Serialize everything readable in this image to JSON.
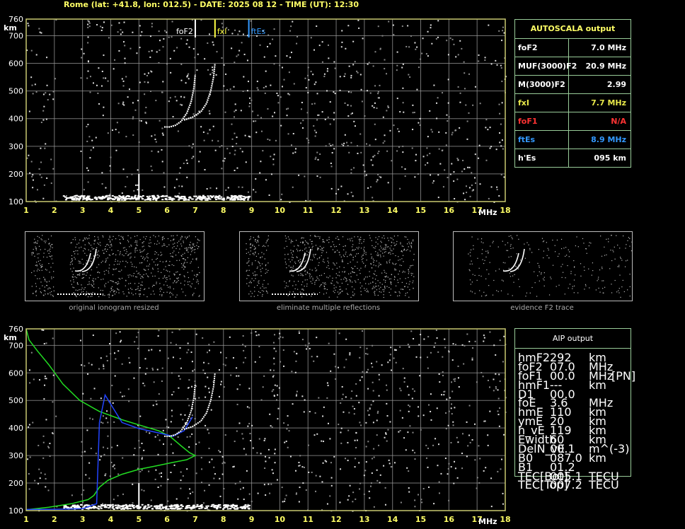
{
  "header": "Rome (lat: +41.8, lon: 012.5) - DATE: 2025 08 12 - TIME (UT): 12:30",
  "colors": {
    "accent": "#ffff66",
    "frame": "#c8c870",
    "grid": "#9a9a9a",
    "fxI": "#ffff44",
    "ftEs": "#3399ff",
    "foF1": "#ff3333",
    "profile": "#22dd22",
    "blue": "#2244ff"
  },
  "axes": {
    "x_unit": "MHz",
    "y_unit": "km",
    "x_ticks": [
      "1",
      "2",
      "3",
      "4",
      "5",
      "6",
      "7",
      "8",
      "9",
      "10",
      "11",
      "12",
      "13",
      "14",
      "15",
      "16",
      "17",
      "18"
    ],
    "y_ticks": [
      "100",
      "200",
      "300",
      "400",
      "500",
      "600",
      "700",
      "760"
    ]
  },
  "top_plot_labels": {
    "foF2": "foF2",
    "fxI": "fxI",
    "ftEs": "ftEs"
  },
  "autoscala": {
    "title": "AUTOSCALA output",
    "rows": [
      {
        "label": "foF2",
        "value": "7.0 MHz",
        "color": "#ffffff"
      },
      {
        "label": "MUF(3000)F2",
        "value": "20.9 MHz",
        "color": "#ffffff"
      },
      {
        "label": "M(3000)F2",
        "value": "2.99",
        "color": "#ffffff"
      },
      {
        "label": "fxI",
        "value": "7.7 MHz",
        "color": "#e8e84a"
      },
      {
        "label": "foF1",
        "value": "N/A",
        "color": "#ff3333"
      },
      {
        "label": "ftEs",
        "value": "8.9 MHz",
        "color": "#3399ff"
      },
      {
        "label": "h'Es",
        "value": "095     km",
        "color": "#ffffff"
      }
    ]
  },
  "thumbnails": [
    {
      "caption": "original ionogram resized"
    },
    {
      "caption": "eliminate multiple reflections"
    },
    {
      "caption": "evidence F2 trace"
    }
  ],
  "aip": {
    "title": "AIP output",
    "rows": [
      {
        "name": "hmF2",
        "value": "292",
        "unit": "km",
        "extra": ""
      },
      {
        "name": "foF2",
        "value": "07.0",
        "unit": "MHz",
        "extra": ""
      },
      {
        "name": "foF1",
        "value": "00.0",
        "unit": "MHz",
        "extra": "[PN]"
      },
      {
        "name": "hmF1",
        "value": "---",
        "unit": "km",
        "extra": ""
      },
      {
        "name": "D1",
        "value": "00.0",
        "unit": "",
        "extra": ""
      },
      {
        "name": "foE",
        "value": "3.6",
        "unit": "MHz",
        "extra": ""
      },
      {
        "name": "hmE",
        "value": "110",
        "unit": "km",
        "extra": ""
      },
      {
        "name": "ymE",
        "value": "20",
        "unit": "km",
        "extra": ""
      },
      {
        "name": "h_vE",
        "value": "119",
        "unit": "km",
        "extra": ""
      },
      {
        "name": "Ewidth",
        "value": "60",
        "unit": "km",
        "extra": ""
      },
      {
        "name": "DelN_vE",
        "value": "00.1",
        "unit": "m^(-3)",
        "extra": ""
      },
      {
        "name": "B0",
        "value": "087.0",
        "unit": "km",
        "extra": ""
      },
      {
        "name": "B1",
        "value": "01.2",
        "unit": "",
        "extra": ""
      },
      {
        "name": "TEC[Bot]",
        "value": "005.1",
        "unit": "TECU",
        "extra": ""
      },
      {
        "name": "TEC[Top]",
        "value": "007.2",
        "unit": "TECU",
        "extra": ""
      }
    ]
  },
  "chart_data": [
    {
      "type": "scatter",
      "title": "",
      "xlabel": "MHz",
      "ylabel": "km",
      "xlim": [
        1,
        18
      ],
      "ylim": [
        100,
        760
      ],
      "grid": true,
      "markers": [
        {
          "name": "foF2",
          "x": 7.0
        },
        {
          "name": "fxI",
          "x": 7.7
        },
        {
          "name": "ftEs",
          "x": 8.9
        }
      ],
      "series": [
        {
          "name": "foF2",
          "points": [
            [
              5.9,
              370
            ],
            [
              6.1,
              370
            ],
            [
              6.3,
              376
            ],
            [
              6.5,
              390
            ],
            [
              6.7,
              420
            ],
            [
              6.85,
              460
            ],
            [
              6.95,
              510
            ],
            [
              7.0,
              560
            ]
          ]
        },
        {
          "name": "fxI",
          "points": [
            [
              6.6,
              395
            ],
            [
              6.9,
              405
            ],
            [
              7.2,
              425
            ],
            [
              7.4,
              455
            ],
            [
              7.55,
              500
            ],
            [
              7.65,
              550
            ],
            [
              7.7,
              600
            ]
          ]
        },
        {
          "name": "Es",
          "points": [
            [
              2.3,
              115
            ],
            [
              4,
              115
            ],
            [
              6,
              117
            ],
            [
              8,
              115
            ],
            [
              8.9,
              115
            ]
          ]
        }
      ]
    },
    {
      "type": "line",
      "title": "",
      "xlabel": "MHz",
      "ylabel": "km",
      "xlim": [
        1,
        18
      ],
      "ylim": [
        100,
        760
      ],
      "grid": true,
      "series": [
        {
          "name": "",
          "points": [
            [
              1.0,
              760
            ],
            [
              1.1,
              720
            ],
            [
              1.4,
              680
            ],
            [
              1.8,
              630
            ],
            [
              2.3,
              560
            ],
            [
              2.9,
              500
            ],
            [
              3.6,
              460
            ],
            [
              4.4,
              430
            ],
            [
              5.2,
              405
            ],
            [
              5.7,
              390
            ],
            [
              6.1,
              370
            ],
            [
              6.5,
              335
            ],
            [
              6.8,
              310
            ],
            [
              7.0,
              300
            ],
            [
              6.7,
              285
            ],
            [
              6.2,
              275
            ],
            [
              5.6,
              262
            ],
            [
              5.0,
              250
            ],
            [
              4.4,
              232
            ],
            [
              3.9,
              210
            ],
            [
              3.6,
              185
            ],
            [
              3.4,
              155
            ],
            [
              3.2,
              140
            ],
            [
              2.6,
              125
            ],
            [
              1.8,
              112
            ],
            [
              1.0,
              103
            ]
          ]
        },
        {
          "name": "",
          "points": [
            [
              1.0,
              104
            ],
            [
              2.0,
              105
            ],
            [
              3.0,
              107
            ],
            [
              3.5,
              125
            ],
            [
              3.6,
              420
            ],
            [
              3.7,
              470
            ],
            [
              3.8,
              520
            ],
            [
              4.4,
              420
            ],
            [
              5.0,
              398
            ],
            [
              5.8,
              380
            ],
            [
              6.2,
              370
            ],
            [
              6.6,
              390
            ],
            [
              6.9,
              440
            ]
          ]
        }
      ]
    }
  ]
}
